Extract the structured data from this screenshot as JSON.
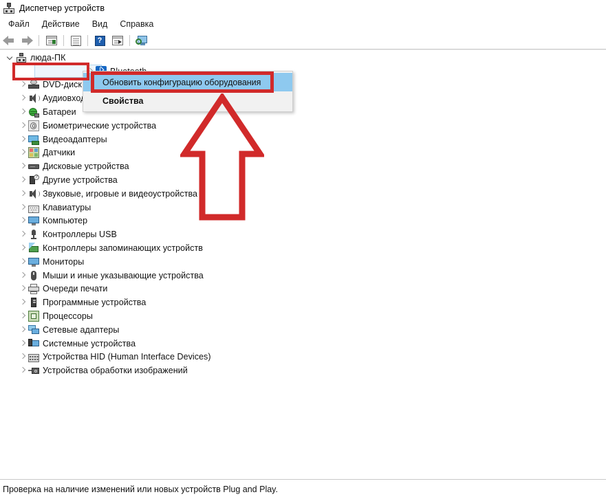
{
  "window": {
    "title": "Диспетчер устройств",
    "title_icon": "device-manager-icon"
  },
  "menubar": {
    "items": [
      {
        "label": "Файл",
        "name": "menu-file"
      },
      {
        "label": "Действие",
        "name": "menu-action"
      },
      {
        "label": "Вид",
        "name": "menu-view"
      },
      {
        "label": "Справка",
        "name": "menu-help"
      }
    ]
  },
  "toolbar": {
    "buttons": [
      {
        "name": "back-button",
        "icon": "arrow-left-icon"
      },
      {
        "name": "forward-button",
        "icon": "arrow-right-icon"
      },
      {
        "name": "show-hide-console-tree-button",
        "icon": "console-tree-icon"
      },
      {
        "name": "properties-button",
        "icon": "properties-icon"
      },
      {
        "name": "help-button",
        "icon": "help-icon"
      },
      {
        "name": "update-driver-button",
        "icon": "update-driver-icon"
      },
      {
        "name": "scan-hardware-changes-button",
        "icon": "scan-hardware-icon"
      }
    ]
  },
  "tree": {
    "root": {
      "label": "люда-ПК",
      "icon": "computer-icon",
      "expanded": true
    },
    "items": [
      {
        "label": "Bluetooth",
        "icon": "bluetooth-icon",
        "selected": true
      },
      {
        "label": "DVD-диск",
        "icon": "dvd-drive-icon",
        "selected": false
      },
      {
        "label": "Аудиовходы и аудиовыходы",
        "icon": "audio-icon",
        "selected": false
      },
      {
        "label": "Батареи",
        "icon": "battery-icon",
        "selected": false
      },
      {
        "label": "Биометрические устройства",
        "icon": "biometric-icon",
        "selected": false
      },
      {
        "label": "Видеоадаптеры",
        "icon": "display-adapter-icon",
        "selected": false
      },
      {
        "label": "Датчики",
        "icon": "sensors-icon",
        "selected": false
      },
      {
        "label": "Дисковые устройства",
        "icon": "disk-drive-icon",
        "selected": false
      },
      {
        "label": "Другие устройства",
        "icon": "other-devices-icon",
        "selected": false
      },
      {
        "label": "Звуковые, игровые и видеоустройства",
        "icon": "sound-video-icon",
        "selected": false
      },
      {
        "label": "Клавиатуры",
        "icon": "keyboard-icon",
        "selected": false
      },
      {
        "label": "Компьютер",
        "icon": "monitor-icon",
        "selected": false
      },
      {
        "label": "Контроллеры USB",
        "icon": "usb-icon",
        "selected": false
      },
      {
        "label": "Контроллеры запоминающих устройств",
        "icon": "storage-controller-icon",
        "selected": false
      },
      {
        "label": "Мониторы",
        "icon": "monitor-icon",
        "selected": false
      },
      {
        "label": "Мыши и иные указывающие устройства",
        "icon": "mouse-icon",
        "selected": false
      },
      {
        "label": "Очереди печати",
        "icon": "printer-icon",
        "selected": false
      },
      {
        "label": "Программные устройства",
        "icon": "software-device-icon",
        "selected": false
      },
      {
        "label": "Процессоры",
        "icon": "processor-icon",
        "selected": false
      },
      {
        "label": "Сетевые адаптеры",
        "icon": "network-adapter-icon",
        "selected": false
      },
      {
        "label": "Системные устройства",
        "icon": "system-device-icon",
        "selected": false
      },
      {
        "label": "Устройства HID (Human Interface Devices)",
        "icon": "hid-icon",
        "selected": false
      },
      {
        "label": "Устройства обработки изображений",
        "icon": "imaging-device-icon",
        "selected": false
      }
    ]
  },
  "context_menu": {
    "items": [
      {
        "label": "Обновить конфигурацию оборудования",
        "name": "menu-scan-hardware-changes",
        "highlighted": true,
        "bold": false
      },
      {
        "label": "Свойства",
        "name": "menu-properties",
        "highlighted": false,
        "bold": true
      }
    ]
  },
  "annotations": {
    "highlight_color": "#d12a2a",
    "arrow": {
      "direction": "up",
      "name": "red-arrow-annotation"
    },
    "boxes": [
      {
        "name": "red-box-bluetooth",
        "target": "Bluetooth"
      },
      {
        "name": "red-box-menu-item",
        "target": "Обновить конфигурацию оборудования"
      }
    ]
  },
  "statusbar": {
    "text": "Проверка на наличие изменений или новых устройств Plug and Play."
  }
}
